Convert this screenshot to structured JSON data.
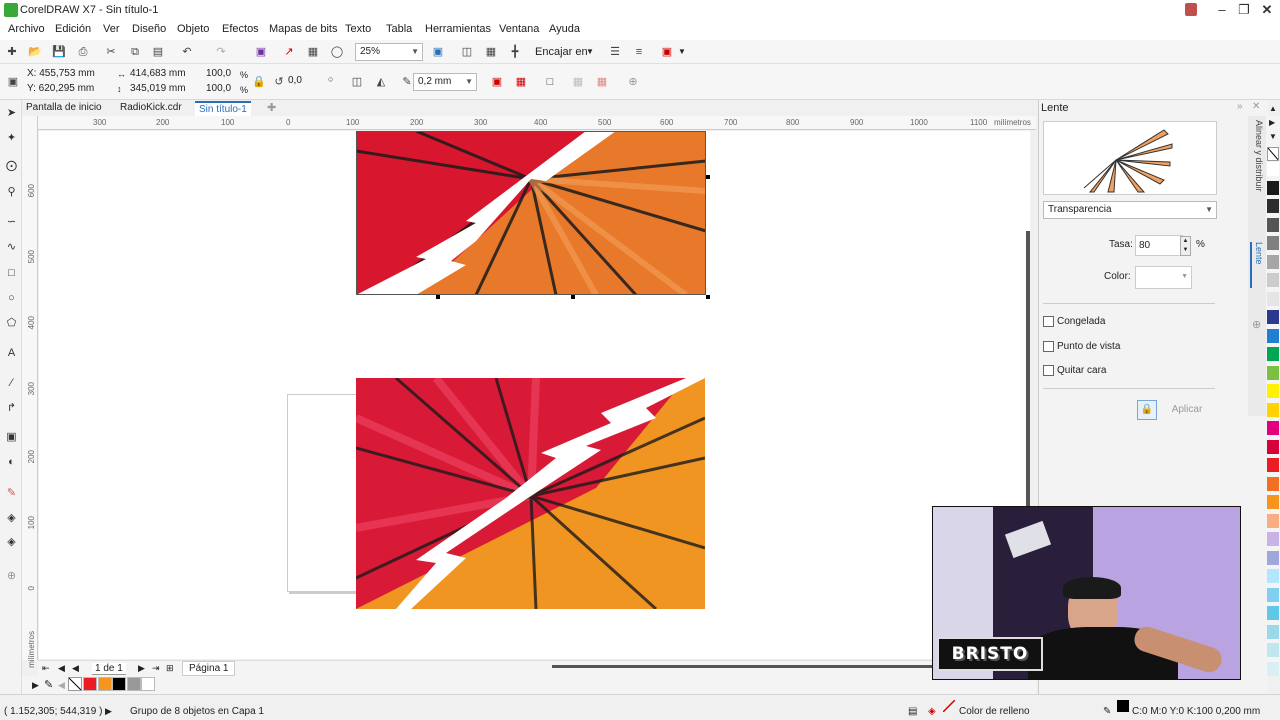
{
  "window": {
    "title": "CorelDRAW X7 - Sin título-1"
  },
  "menu": [
    "Archivo",
    "Edición",
    "Ver",
    "Diseño",
    "Objeto",
    "Efectos",
    "Mapas de bits",
    "Texto",
    "Tabla",
    "Herramientas",
    "Ventana",
    "Ayuda"
  ],
  "toolbar": {
    "zoom": "25%",
    "snap_label": "Encajar en"
  },
  "property_bar": {
    "x": "X: 455,753 mm",
    "y": "Y: 620,295 mm",
    "width": "414,683 mm",
    "height": "345,019 mm",
    "scale_x": "100,0",
    "scale_y": "100,0",
    "pct": "%",
    "rotation": "0,0",
    "outline": "0,2 mm"
  },
  "doc_tabs": [
    "Pantalla de inicio",
    "RadioKick.cdr",
    "Sin título-1"
  ],
  "ruler": {
    "h_ticks": [
      "300",
      "200",
      "100",
      "0",
      "100",
      "200",
      "300",
      "400",
      "500",
      "600",
      "700",
      "800",
      "900",
      "1000",
      "1100"
    ],
    "h_unit": "milímetros",
    "v_ticks": [
      "600",
      "500",
      "400",
      "300",
      "200",
      "100",
      "0"
    ],
    "v_unit": "milímetros"
  },
  "page_nav": {
    "counter": "1 de 1",
    "page_tab": "Página 1"
  },
  "docker": {
    "title": "Lente",
    "mode": "Transparencia",
    "rate_label": "Tasa:",
    "rate_value": "80",
    "rate_unit": "%",
    "color_label": "Color:",
    "checkboxes": [
      "Congelada",
      "Punto de vista",
      "Quitar cara"
    ],
    "apply": "Aplicar",
    "side_tabs": [
      "Alinear y distribuir",
      "Lente"
    ]
  },
  "status": {
    "coords": "( 1.152,305; 544,319 )",
    "selection": "Grupo de 8 objetos en Capa 1",
    "fill": "Color de relleno",
    "outline": "C:0 M:0 Y:0 K:100  0,200 mm"
  },
  "webcam": {
    "logo": "BRISTO"
  },
  "colors": {
    "palette": [
      "#ffffff",
      "#1a1a1a",
      "#2d2d2d",
      "#555555",
      "#808080",
      "#a6a6a6",
      "#cccccc",
      "#e5e5e5",
      "#2b3a8f",
      "#1f7fd1",
      "#00a650",
      "#7ac143",
      "#fff200",
      "#ffd200",
      "#e4007c",
      "#d6003b",
      "#ec1c24",
      "#f36f21",
      "#f7941d",
      "#f9ad81",
      "#c7b3e6",
      "#9fa8da",
      "#b3e5fc",
      "#7fd0f0",
      "#5fc8e8",
      "#9ad9ea",
      "#bfe7f0",
      "#d9eef5"
    ],
    "bottom_palette": [
      "#ec1c24",
      "#f7941d",
      "#000000",
      "#999999",
      "#ffffff"
    ]
  }
}
